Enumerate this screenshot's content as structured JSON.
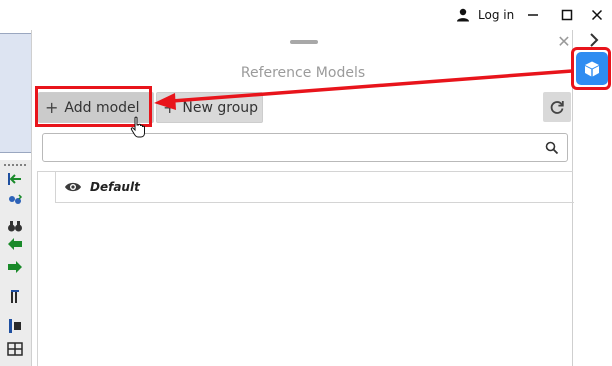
{
  "titlebar": {
    "login_label": "Log in",
    "user_icon": "user-icon",
    "minimize_icon": "minimize-icon",
    "maximize_icon": "maximize-icon",
    "close_icon": "close-icon"
  },
  "panel": {
    "title": "Reference Models",
    "close_icon": "close-icon",
    "add_model_label": "Add model",
    "new_group_label": "New group",
    "refresh_icon": "refresh-icon",
    "search": {
      "value": "",
      "placeholder": "",
      "icon": "search-icon"
    },
    "tree": [
      {
        "label": "Default",
        "icon": "eye-icon"
      }
    ]
  },
  "sidebar_right": {
    "collapse_icon": "chevron-right-icon",
    "reference_models_icon": "cube-icon"
  },
  "annotation": {
    "highlight_color": "#e8141b",
    "accent_color": "#2f8cf1"
  }
}
